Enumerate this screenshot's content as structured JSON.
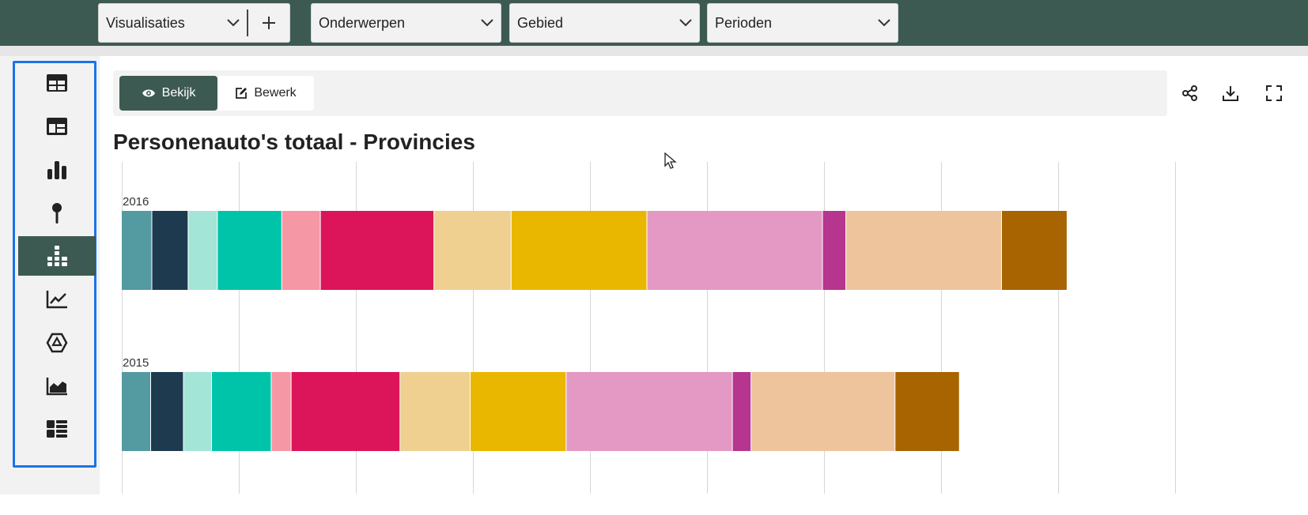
{
  "topbar": {
    "visualisaties_label": "Visualisaties",
    "onderwerpen_label": "Onderwerpen",
    "gebied_label": "Gebied",
    "perioden_label": "Perioden"
  },
  "sidebar": {
    "items": [
      {
        "name": "table-icon",
        "active": false
      },
      {
        "name": "dashboard-table-icon",
        "active": false
      },
      {
        "name": "bar-chart-icon",
        "active": false
      },
      {
        "name": "map-pin-icon",
        "active": false
      },
      {
        "name": "stacked-bar-icon",
        "active": true
      },
      {
        "name": "line-chart-icon",
        "active": false
      },
      {
        "name": "shape-icon",
        "active": false
      },
      {
        "name": "area-chart-icon",
        "active": false
      },
      {
        "name": "tile-view-icon",
        "active": false
      }
    ]
  },
  "toolbar": {
    "view_label": "Bekijk",
    "edit_label": "Bewerk"
  },
  "title": "Personenauto's totaal - Provincies",
  "colors": {
    "brand": "#3c5a52",
    "selection": "#1a73e8",
    "palette": [
      "#539aa1",
      "#1d3a4f",
      "#a3e5d6",
      "#00c4aa",
      "#f597a4",
      "#dc1459",
      "#efd091",
      "#e9b700",
      "#e399c3",
      "#b6358e",
      "#edc49c",
      "#a76400"
    ]
  },
  "chart_data": {
    "type": "bar",
    "orientation": "horizontal",
    "stacked": true,
    "title": "Personenauto's totaal - Provincies",
    "categories": [
      "2016",
      "2015"
    ],
    "segments_per_bar": 12,
    "series": [
      {
        "values": [
          26,
          25
        ]
      },
      {
        "values": [
          31,
          28
        ]
      },
      {
        "values": [
          25,
          24
        ]
      },
      {
        "values": [
          55,
          51
        ]
      },
      {
        "values": [
          33,
          17
        ]
      },
      {
        "values": [
          97,
          93
        ]
      },
      {
        "values": [
          66,
          60
        ]
      },
      {
        "values": [
          116,
          82
        ]
      },
      {
        "values": [
          150,
          142
        ]
      },
      {
        "values": [
          20,
          16
        ]
      },
      {
        "values": [
          133,
          123
        ]
      },
      {
        "values": [
          56,
          55
        ]
      }
    ],
    "xlim": [
      0,
      1000
    ],
    "grid": true,
    "legend": "none"
  }
}
